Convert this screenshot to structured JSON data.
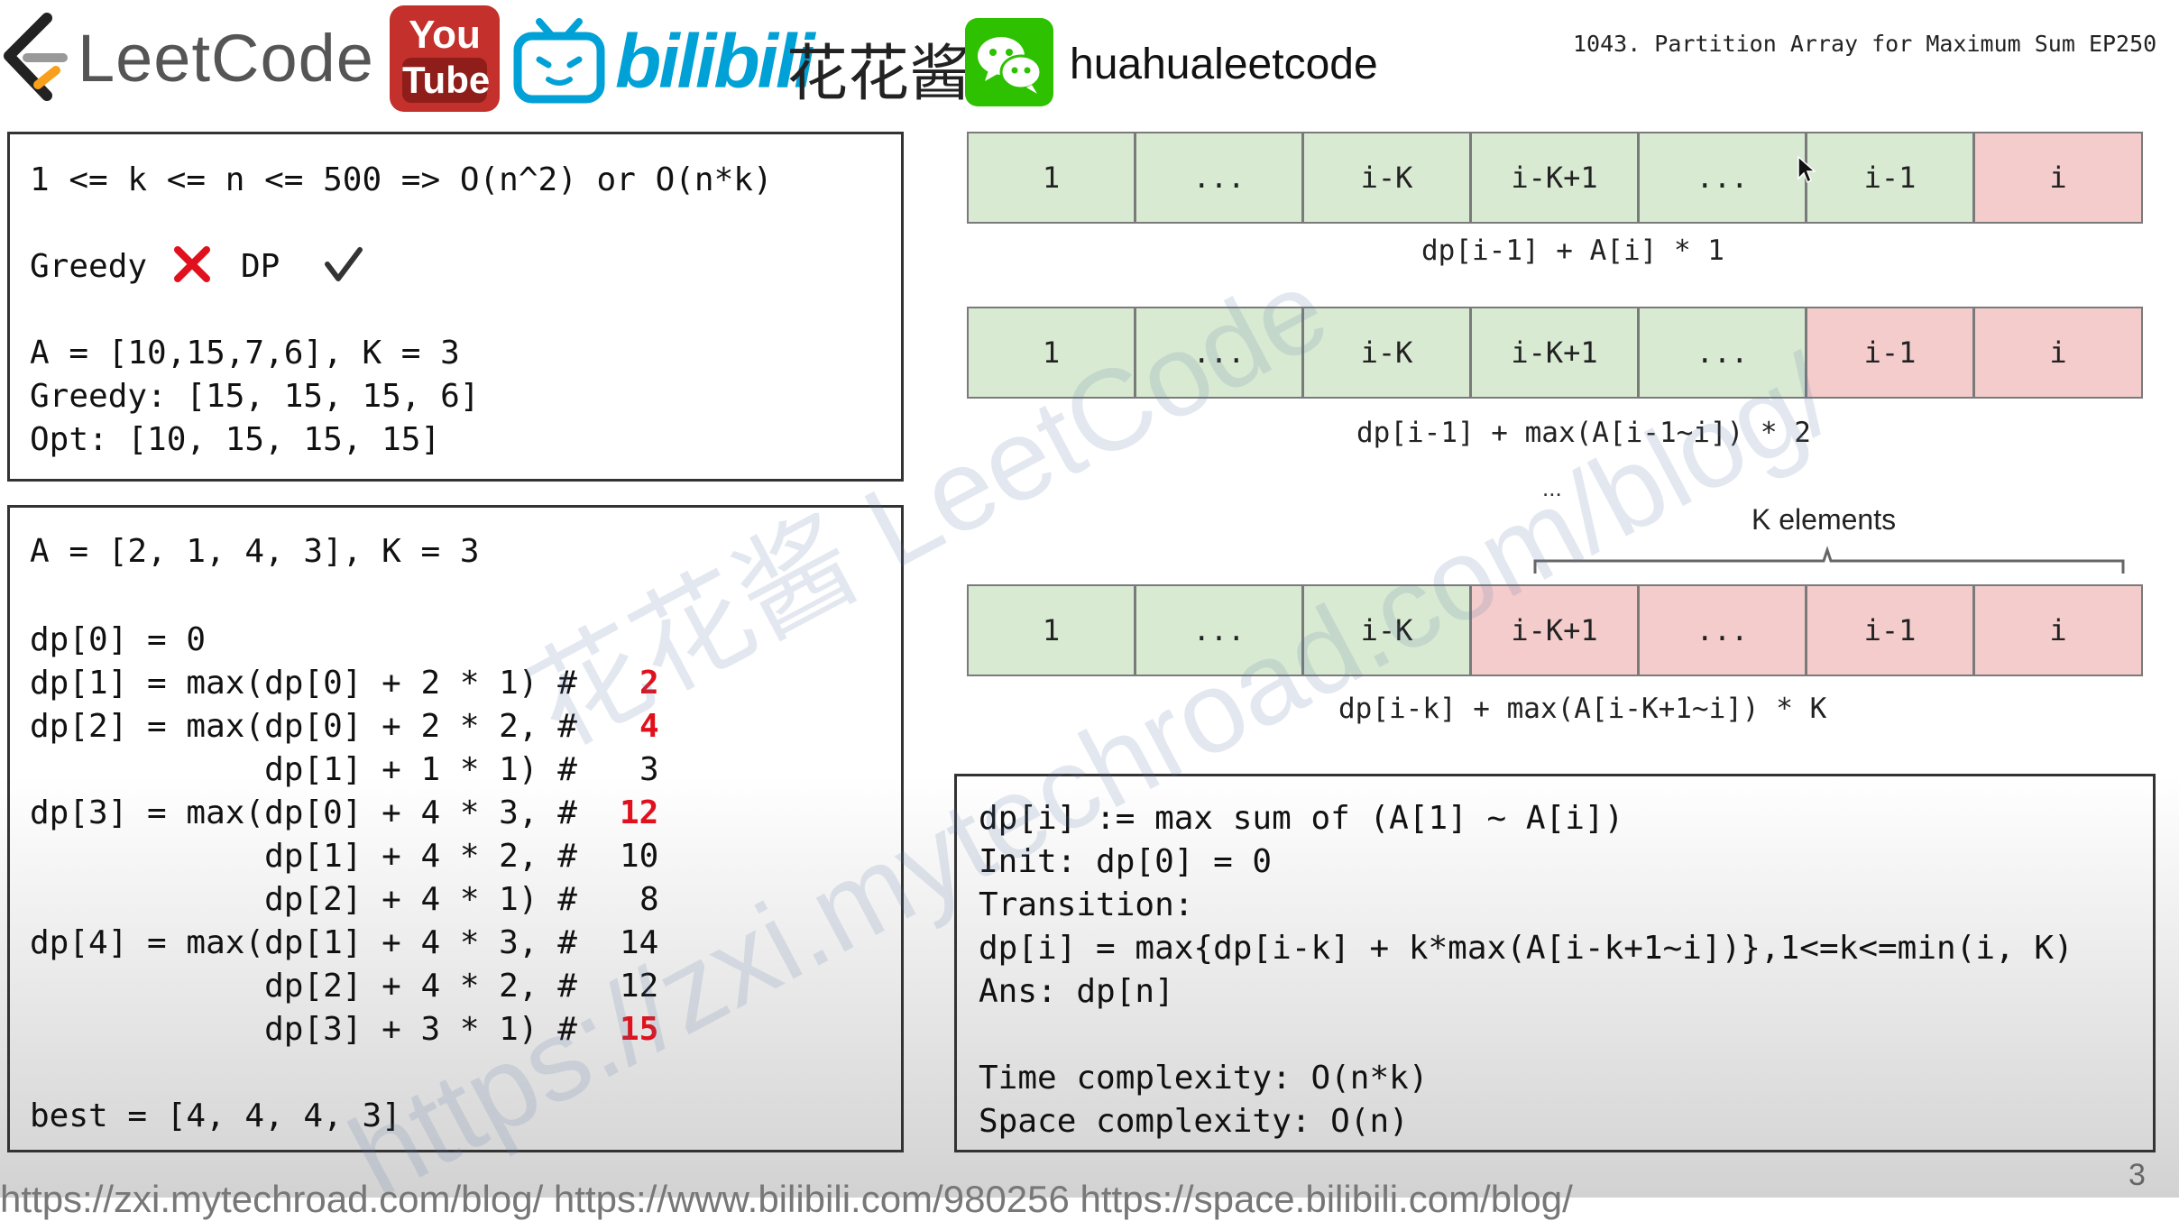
{
  "header": {
    "leetcode_text": "LeetCode",
    "youtube_you": "You",
    "youtube_tube": "Tube",
    "bilibili_text": "bilibili",
    "chinese_name": "花花酱",
    "handle": "huahualeetcode",
    "slide_title": "1043. Partition Array for Maximum Sum EP250"
  },
  "top_left_box": {
    "line1": "1 <= k <= n <= 500 => O(n^2) or O(n*k)",
    "greedy_label": "Greedy",
    "dp_label": "DP",
    "example": "A = [10,15,7,6], K = 3",
    "greedy_result": "Greedy: [15, 15, 15, 6]",
    "opt_result": "Opt: [10, 15, 15, 15]"
  },
  "bottom_left_box": {
    "l1": "A = [2, 1, 4, 3], K = 3",
    "l2": "dp[0] = 0",
    "l3": "dp[1] = max(dp[0] + 2 * 1) #",
    "l3v": "2",
    "l4": "dp[2] = max(dp[0] + 2 * 2, #",
    "l4v": "4",
    "l5": "            dp[1] + 1 * 1) #",
    "l5v": "3",
    "l6": "dp[3] = max(dp[0] + 4 * 3, #",
    "l6v": "12",
    "l7": "            dp[1] + 4 * 2, #",
    "l7v": "10",
    "l8": "            dp[2] + 4 * 1) #",
    "l8v": "8",
    "l9": "dp[4] = max(dp[1] + 4 * 3, #",
    "l9v": "14",
    "l10": "            dp[2] + 4 * 2, #",
    "l10v": "12",
    "l11": "            dp[3] + 3 * 1) #",
    "l11v": "15",
    "l12": "best = [4, 4, 4, 3]"
  },
  "rows": {
    "cells": [
      "1",
      "...",
      "i-K",
      "i-K+1",
      "...",
      "i-1",
      "i"
    ],
    "row1_caption": "dp[i-1] + A[i] * 1",
    "row2_caption": "dp[i-1] + max(A[i-1~i]) * 2",
    "ellipsis": "...",
    "k_elements_label": "K elements",
    "row3_caption": "dp[i-k] + max(A[i-K+1~i]) * K"
  },
  "summary_box": {
    "l1": "dp[i] := max sum of (A[1] ~ A[i])",
    "l2": "Init: dp[0] = 0",
    "l3": "Transition:",
    "l4": "dp[i] = max{dp[i-k] + k*max(A[i-k+1~i])},1<=k<=min(i, K)",
    "l5": "Ans: dp[n]",
    "l6": "Time complexity: O(n*k)",
    "l7": "Space complexity: O(n)"
  },
  "watermark": {
    "line1": "花花酱 LeetCode",
    "line2": "https://zxi.mytechroad.com/blog/"
  },
  "footer": {
    "urls": "https://zxi.mytechroad.com/blog/ https://www.bilibili.com/980256 https://space.bilibili.com/blog/",
    "page_number": "3"
  },
  "colors": {
    "green_cell": "#d9ead3",
    "red_cell": "#f4cccc",
    "highlight_red": "#e0111d",
    "bilibili_blue": "#00a1d6",
    "youtube_red": "#c4302b",
    "wechat_green": "#2dc100"
  }
}
